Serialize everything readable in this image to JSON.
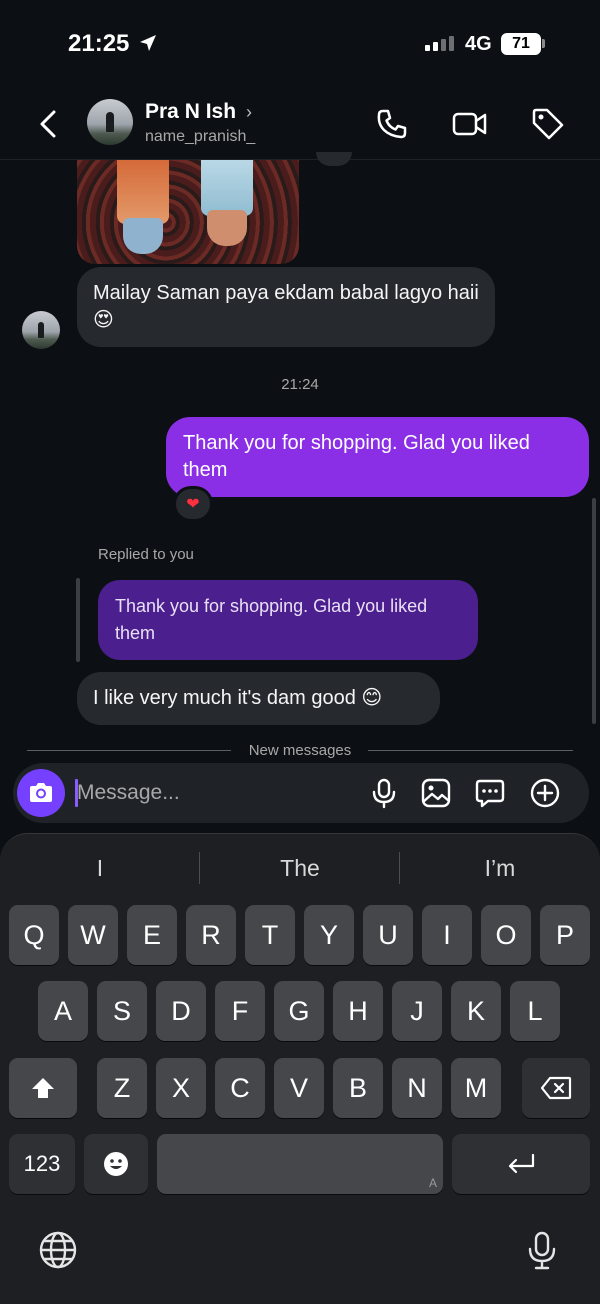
{
  "status_bar": {
    "time": "21:25",
    "network": "4G",
    "battery": "71"
  },
  "header": {
    "name": "Pra N Ish",
    "chevron": "›",
    "username": "name_pranish_",
    "icons": [
      "back-arrow-icon",
      "phone-icon",
      "video-camera-icon",
      "tag-icon"
    ]
  },
  "messages": {
    "incoming_1": "Mailay Saman paya ekdam babal lagyo haii 😍",
    "timestamp": "21:24",
    "outgoing_1": "Thank you for shopping. Glad you liked them",
    "reaction": "❤",
    "replied_label": "Replied to you",
    "quoted_text": "Thank you for shopping. Glad you liked them",
    "incoming_2": "I like very much it's dam good 😊",
    "new_messages_label": "New messages"
  },
  "composer": {
    "placeholder": "Message...",
    "icons": [
      "camera-icon",
      "microphone-icon",
      "image-icon",
      "sticker-chat-icon",
      "plus-icon"
    ]
  },
  "keyboard": {
    "suggestions": [
      "I",
      "The",
      "I’m"
    ],
    "row1": [
      "Q",
      "W",
      "E",
      "R",
      "T",
      "Y",
      "U",
      "I",
      "O",
      "P"
    ],
    "row2": [
      "A",
      "S",
      "D",
      "F",
      "G",
      "H",
      "J",
      "K",
      "L"
    ],
    "row3": [
      "Z",
      "X",
      "C",
      "V",
      "B",
      "N",
      "M"
    ],
    "numbers_key": "123",
    "space_hint": "A",
    "icons": [
      "shift-icon",
      "backspace-icon",
      "emoji-icon",
      "return-icon",
      "globe-icon",
      "dictation-mic-icon"
    ]
  },
  "colors": {
    "background": "#0c1014",
    "incoming_bubble": "#262a2f",
    "outgoing_bubble": "#8b2fe6",
    "quoted_bubble": "#4c1f8f",
    "accent": "#7540ff"
  }
}
